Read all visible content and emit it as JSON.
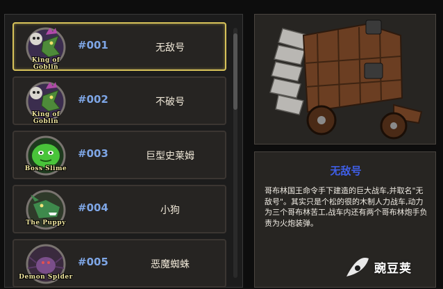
{
  "list": {
    "items": [
      {
        "badge_label": "King of Goblin",
        "number": "#001",
        "name": "无敌号",
        "selected": true
      },
      {
        "badge_label": "King of Goblin",
        "number": "#002",
        "name": "不破号",
        "selected": false
      },
      {
        "badge_label": "Boss Slime",
        "number": "#003",
        "name": "巨型史莱姆",
        "selected": false
      },
      {
        "badge_label": "The Puppy",
        "number": "#004",
        "name": "小狗",
        "selected": false
      },
      {
        "badge_label": "Demon Spider",
        "number": "#005",
        "name": "恶魔蜘蛛",
        "selected": false
      }
    ]
  },
  "detail": {
    "title": "无敌号",
    "description": "哥布林国王命令手下建造的巨大战车,并取名\"无敌号\"。其实只是个松的很的木制人力战车,动力为三个哥布林苦工,战车内还有两个哥布林炮手负责为火炮装弹。"
  },
  "watermark": {
    "text": "豌豆荚"
  },
  "colors": {
    "accent_number": "#7ea6e6",
    "title_blue": "#3f5fe8",
    "selected_border": "#d8c35a"
  }
}
